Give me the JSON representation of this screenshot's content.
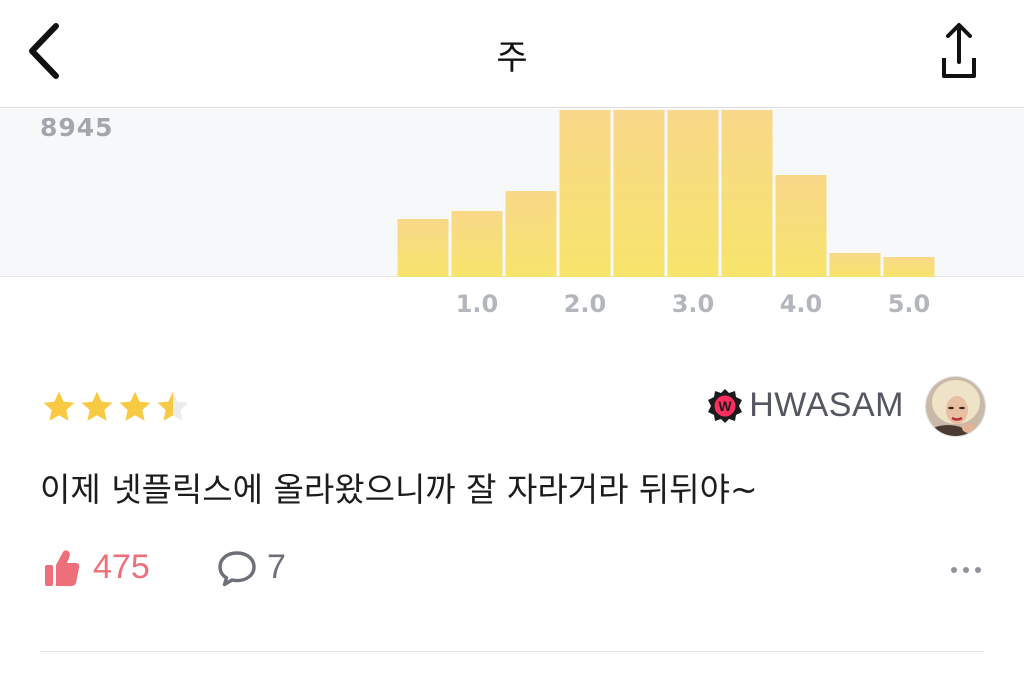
{
  "header": {
    "title": "주",
    "back_icon": "chevron-left-icon",
    "share_icon": "share-icon"
  },
  "distribution": {
    "max_count_label": "8945",
    "bar_color_top": "#f8d889",
    "bar_color_bottom": "#f7e46c",
    "ticks": [
      "1.0",
      "2.0",
      "3.0",
      "4.0",
      "5.0"
    ]
  },
  "chart_data": {
    "type": "bar",
    "categories": [
      "0.5",
      "1.0",
      "1.5",
      "2.0",
      "2.5",
      "3.0",
      "3.5",
      "4.0",
      "4.5",
      "5.0"
    ],
    "values": [
      0,
      3080,
      3560,
      4600,
      8945,
      8945,
      8945,
      8945,
      5450,
      1280,
      1050
    ],
    "xlabel": "",
    "ylabel": ""
  },
  "review": {
    "rating": 3.5,
    "author": "HWASAM",
    "badge_icon": "watcha-badge-icon",
    "text": "이제 넷플릭스에 올라왔으니까 잘 자라거라 뒤뒤야~",
    "likes": "475",
    "comments": "7",
    "like_icon": "thumbs-up-icon",
    "comment_icon": "comment-bubble-icon",
    "more_icon": "more-dots-icon",
    "like_color": "#ee6f7a",
    "star_color": "#f8c942"
  }
}
